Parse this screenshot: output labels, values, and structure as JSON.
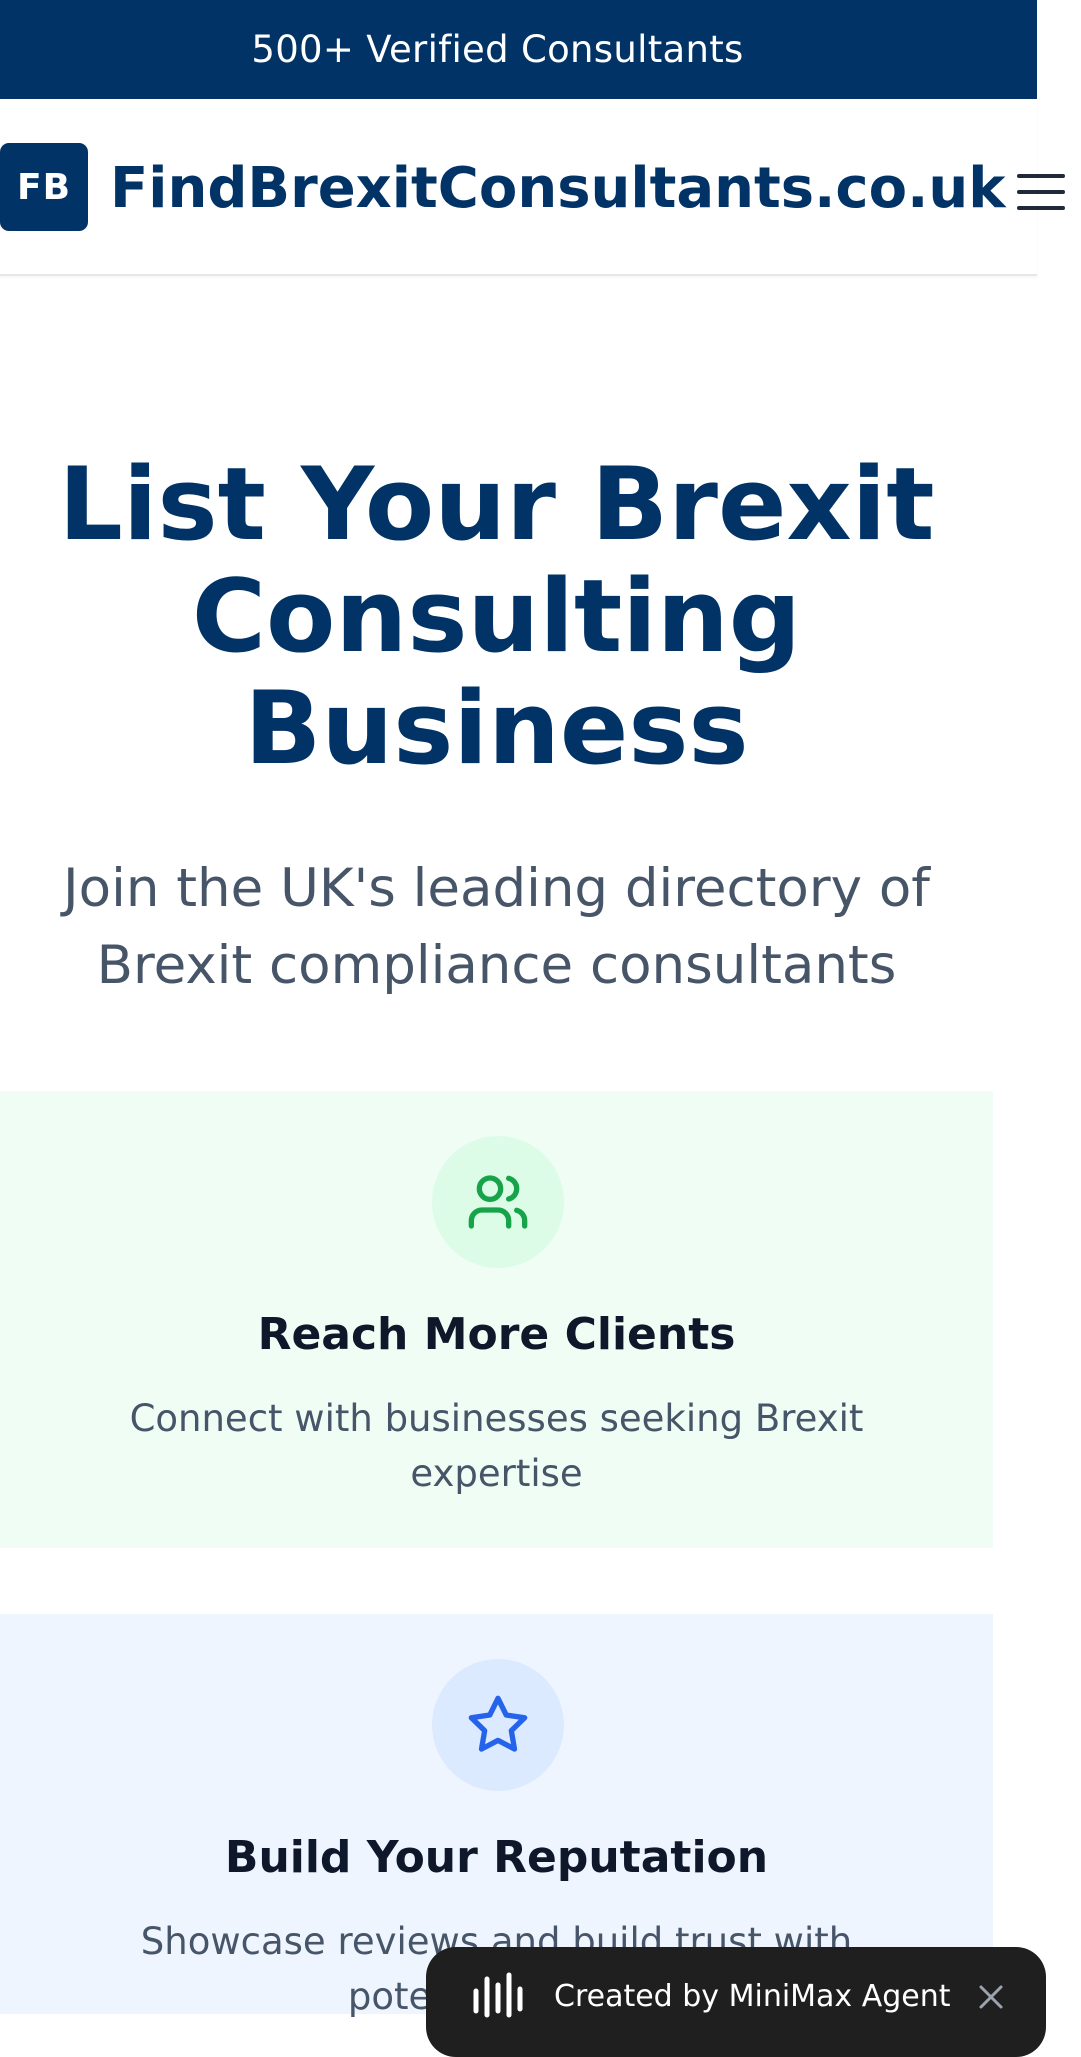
{
  "top_banner": {
    "text": "500+ Verified Consultants"
  },
  "header": {
    "logo_initials": "FB",
    "site_name": "FindBrexitConsultants.co.uk",
    "menu_icon": "menu-icon"
  },
  "hero": {
    "title": "List Your Brexit Consulting Business",
    "subtitle": "Join the UK's leading directory of Brexit compliance consultants"
  },
  "benefits": [
    {
      "icon": "users-icon",
      "title": "Reach More Clients",
      "description": "Connect with businesses seeking Brexit expertise",
      "background": "#f0fdf4",
      "accent": "#16a34a"
    },
    {
      "icon": "star-icon",
      "title": "Build Your Reputation",
      "description": "Showcase reviews and build trust with potential clients",
      "background": "#eff5ff",
      "accent": "#2563eb"
    }
  ],
  "floating_badge": {
    "text": "Created by MiniMax Agent",
    "icon": "minimax-logo-icon",
    "close_icon": "close-icon"
  },
  "colors": {
    "brand_navy": "#023366",
    "text_dark": "#0f172a",
    "text_muted": "#475569"
  }
}
